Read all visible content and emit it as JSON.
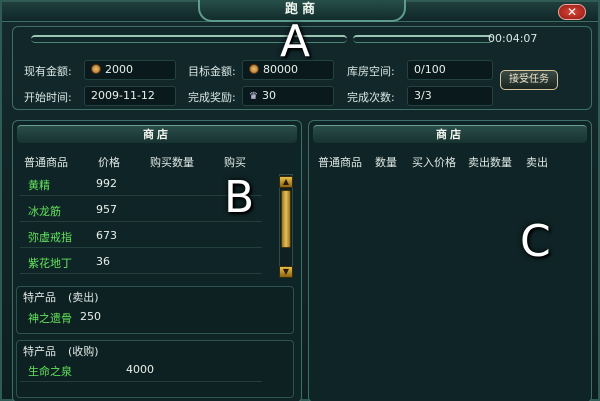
{
  "window": {
    "title": "跑商",
    "close_label": "✕",
    "timer": "00:04:07"
  },
  "overlay_letters": {
    "a": "A",
    "b": "B",
    "c": "C"
  },
  "info": {
    "current_gold_label": "现有金额:",
    "current_gold_value": "2000",
    "target_gold_label": "目标金额:",
    "target_gold_value": "80000",
    "storage_label": "库房空间:",
    "storage_value": "0/100",
    "start_time_label": "开始时间:",
    "start_time_value": "2009-11-12",
    "reward_label": "完成奖励:",
    "reward_value": "30",
    "completions_label": "完成次数:",
    "completions_value": "3/3",
    "task_button": "接受任务"
  },
  "left_shop": {
    "title": "商店",
    "columns": [
      "普通商品",
      "价格",
      "购买数量",
      "购买"
    ],
    "items": [
      {
        "name": "黄精",
        "price": "992"
      },
      {
        "name": "冰龙筋",
        "price": "957"
      },
      {
        "name": "弥虚戒指",
        "price": "673"
      },
      {
        "name": "紫花地丁",
        "price": "36"
      }
    ],
    "special_sell": {
      "title": "特产品",
      "tag": "(卖出)",
      "item": "神之遗骨",
      "price": "250"
    },
    "special_buy": {
      "title": "特产品",
      "tag": "(收购)",
      "item": "生命之泉",
      "price": "4000"
    }
  },
  "right_shop": {
    "title": "商店",
    "columns": [
      "普通商品",
      "数量",
      "买入价格",
      "卖出数量",
      "卖出"
    ]
  },
  "colors": {
    "item_green": "#63e35c",
    "gold": "#e6c15a",
    "close_red": "#d9362a"
  }
}
